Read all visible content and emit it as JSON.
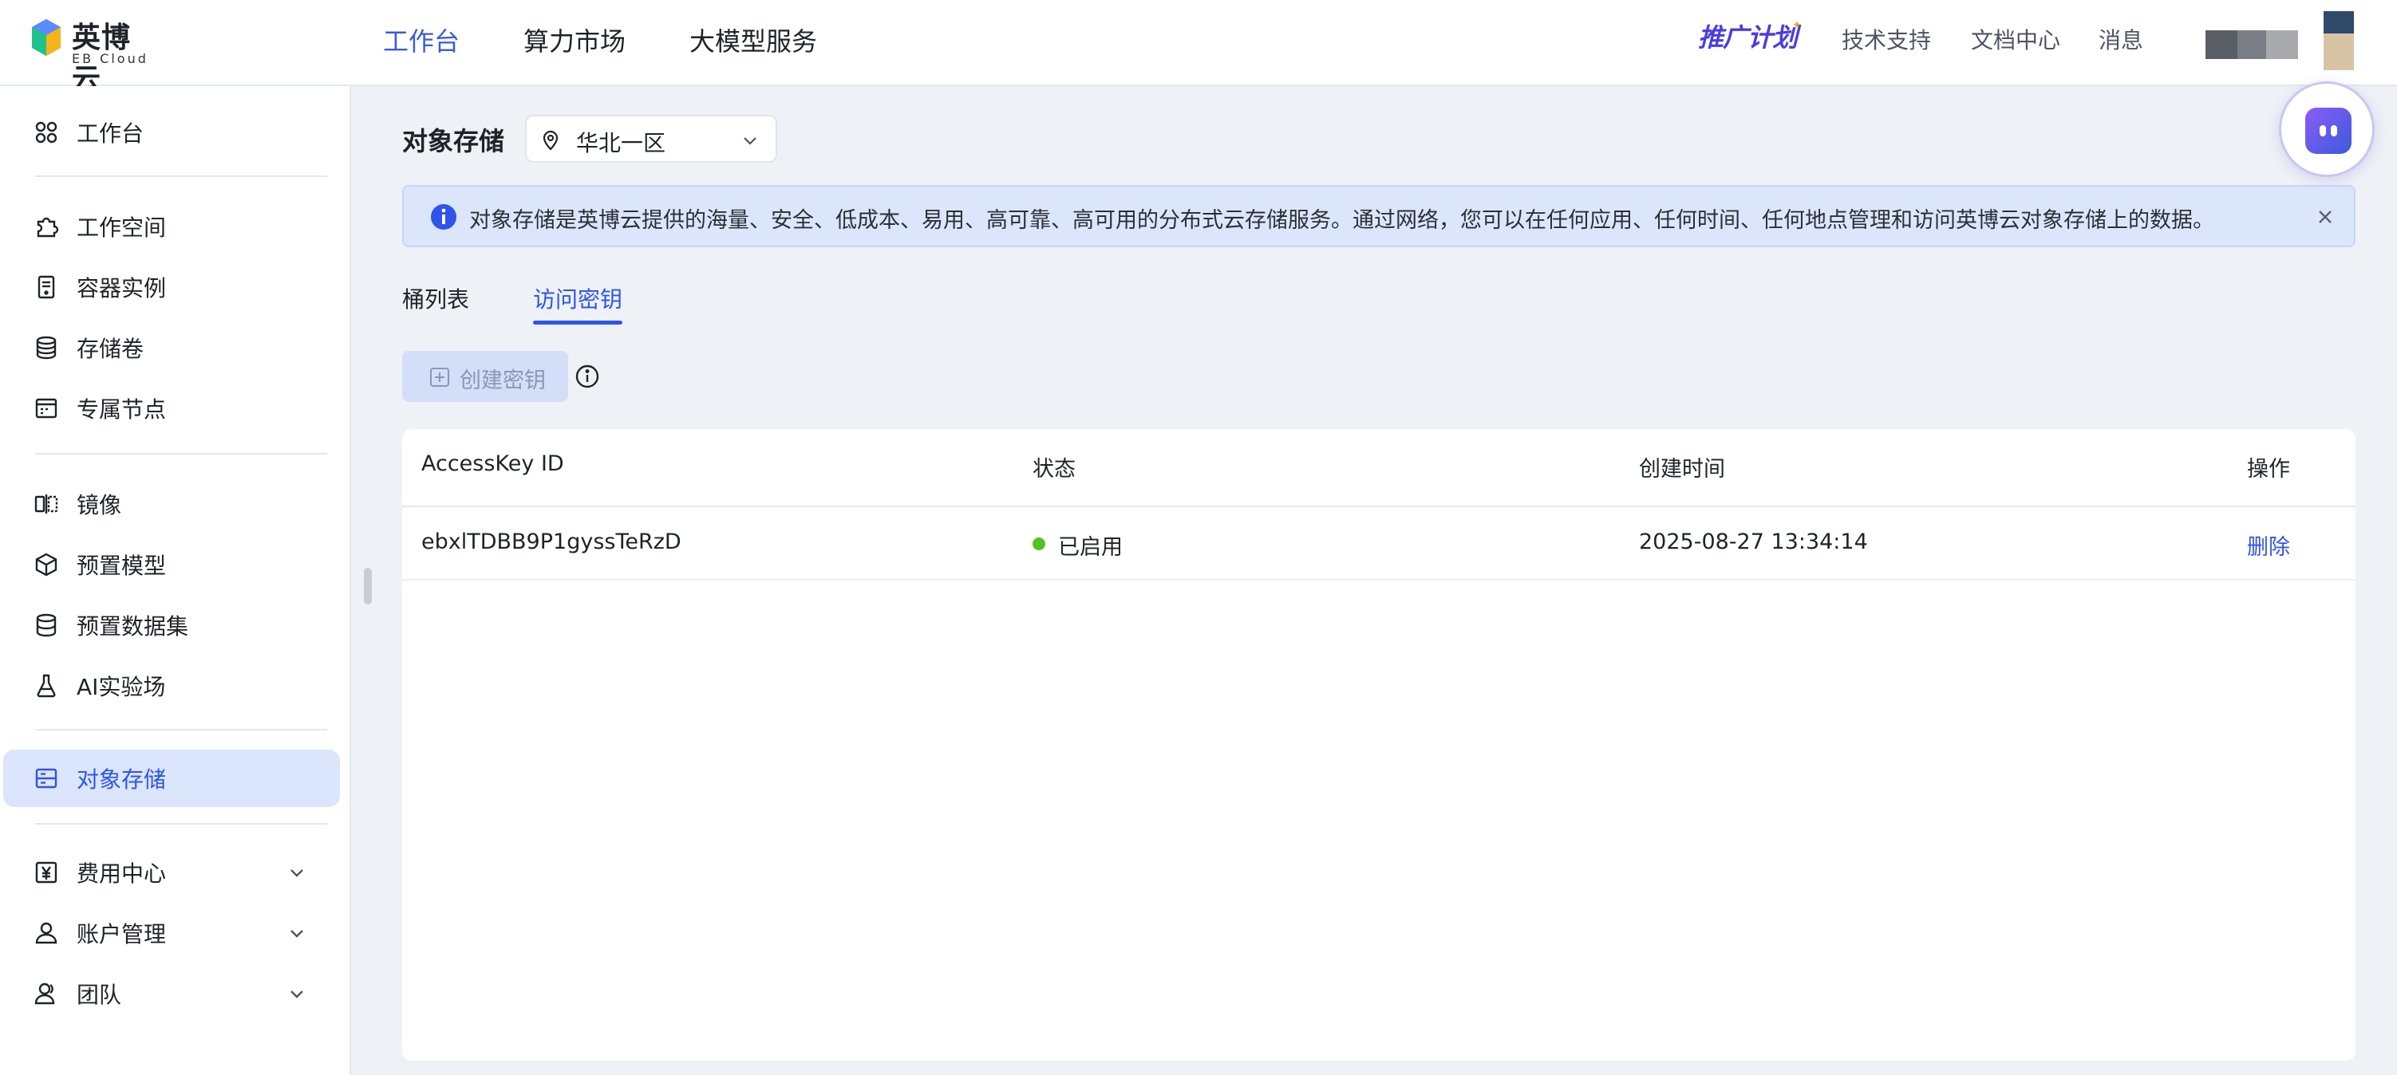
{
  "app": {
    "logo_name": "英博云",
    "logo_sub": "EB Cloud",
    "brand_color": "#2f54eb"
  },
  "topnav": [
    {
      "label": "工作台",
      "active": true
    },
    {
      "label": "算力市场",
      "active": false
    },
    {
      "label": "大模型服务",
      "active": false
    }
  ],
  "topright": {
    "promo": "推广计划",
    "links": [
      "技术支持",
      "文档中心",
      "消息"
    ]
  },
  "sidebar": {
    "items": [
      {
        "label": "工作台",
        "icon": "dashboard-icon"
      },
      {
        "label": "工作空间",
        "icon": "puzzle-icon"
      },
      {
        "label": "容器实例",
        "icon": "container-icon"
      },
      {
        "label": "存储卷",
        "icon": "database-icon"
      },
      {
        "label": "专属节点",
        "icon": "node-icon"
      },
      {
        "label": "镜像",
        "icon": "mirror-icon"
      },
      {
        "label": "预置模型",
        "icon": "cube-icon"
      },
      {
        "label": "预置数据集",
        "icon": "dataset-icon"
      },
      {
        "label": "AI实验场",
        "icon": "flask-icon"
      },
      {
        "label": "对象存储",
        "icon": "storage-icon",
        "active": true
      },
      {
        "label": "费用中心",
        "icon": "yen-icon"
      },
      {
        "label": "账户管理",
        "icon": "user-icon"
      },
      {
        "label": "团队",
        "icon": "team-icon"
      }
    ]
  },
  "main": {
    "title": "对象存储",
    "region": "华北一区",
    "alert": "对象存储是英博云提供的海量、安全、低成本、易用、高可靠、高可用的分布式云存储服务。通过网络，您可以在任何应用、任何时间、任何地点管理和访问英博云对象存储上的数据。",
    "tabs": [
      {
        "label": "桶列表",
        "active": false
      },
      {
        "label": "访问密钥",
        "active": true
      }
    ],
    "create_button": "创建密钥",
    "table": {
      "columns": [
        "AccessKey ID",
        "状态",
        "创建时间",
        "操作"
      ],
      "rows": [
        {
          "id": "ebxlTDBB9P1gyssTeRzD",
          "status": "已启用",
          "created": "2025-08-27 13:34:14",
          "action": "删除"
        }
      ]
    },
    "status_color": "#52c41a"
  }
}
